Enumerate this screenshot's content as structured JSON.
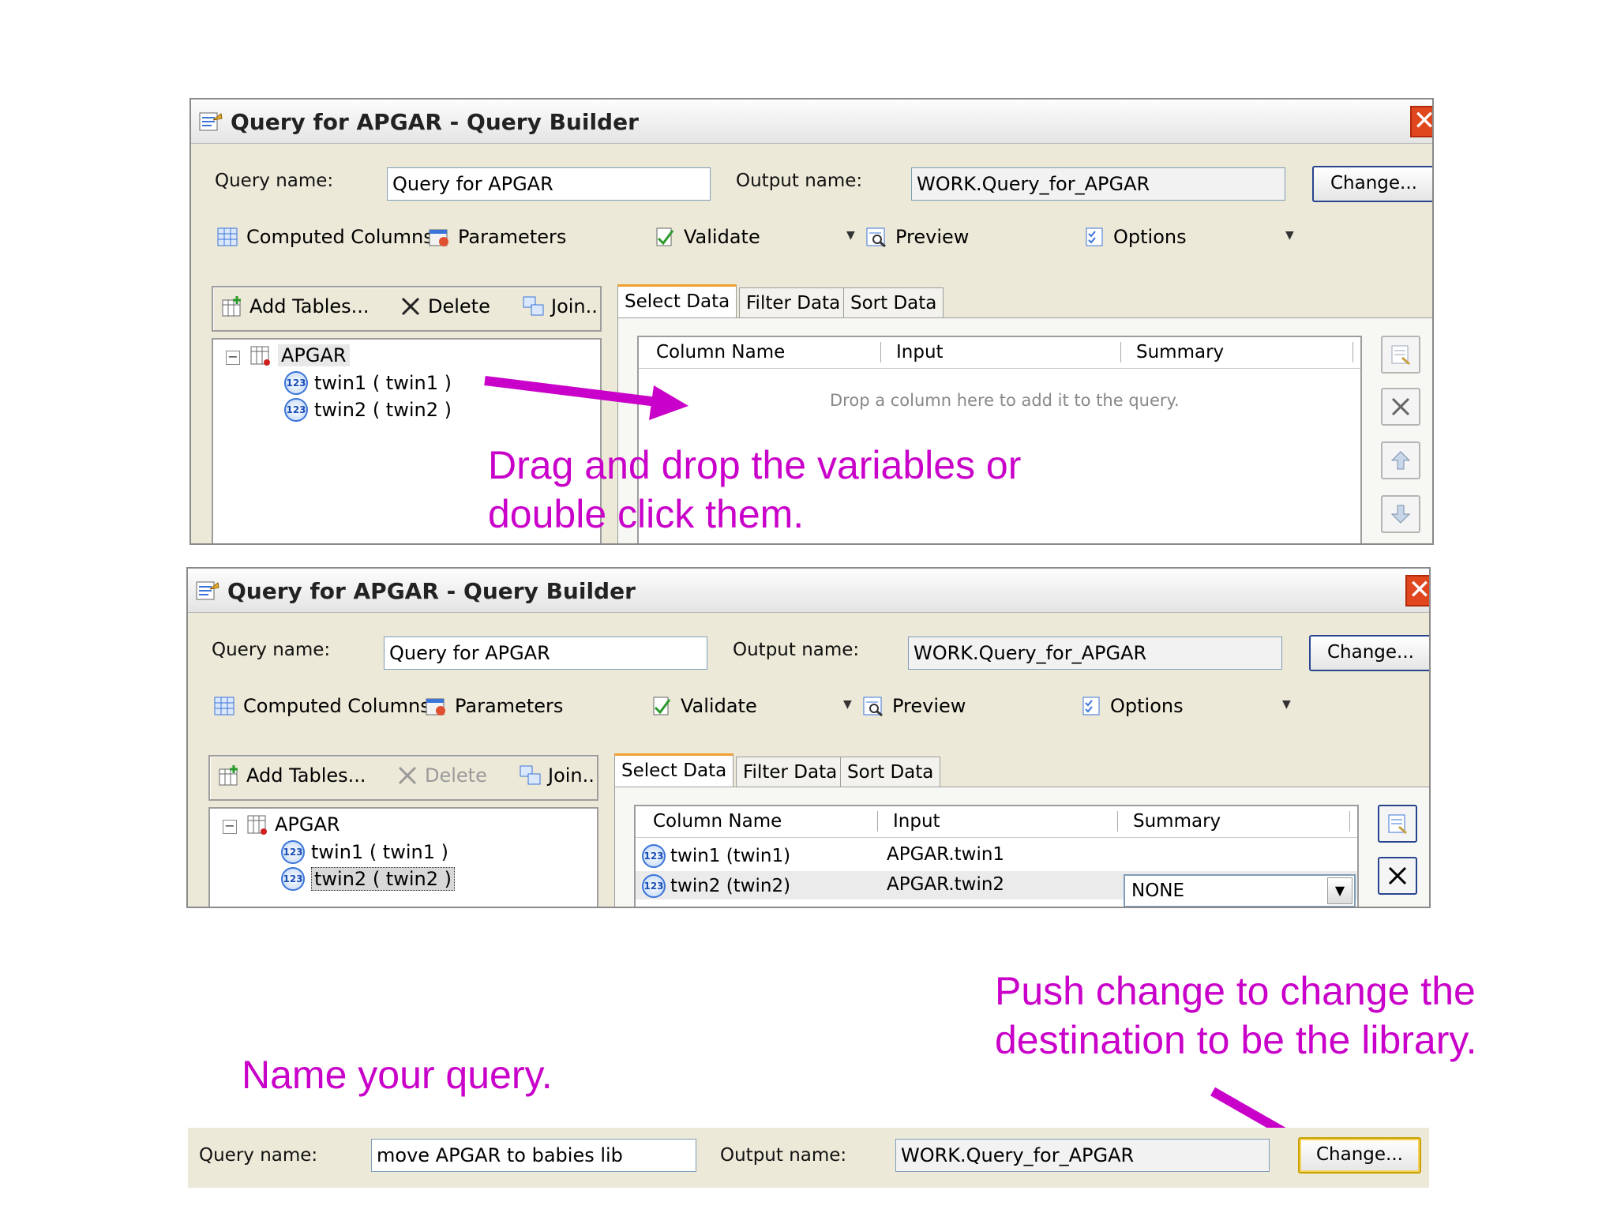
{
  "window1": {
    "title": "Query for APGAR - Query Builder",
    "close_glyph": "✕",
    "query_name_label": "Query name:",
    "query_name_value": "Query for APGAR",
    "output_name_label": "Output name:",
    "output_name_value": "WORK.Query_for_APGAR",
    "change_label": "Change...",
    "toolbar": {
      "computed_columns": "Computed Columns",
      "parameters": "Parameters",
      "validate": "Validate",
      "preview": "Preview",
      "options": "Options"
    },
    "table_tools": {
      "add_tables": "Add Tables...",
      "delete": "Delete",
      "join": "Join.."
    },
    "tree": {
      "table": "APGAR",
      "vars": [
        "twin1 ( twin1 )",
        "twin2 ( twin2 )"
      ]
    },
    "tabs": [
      "Select Data",
      "Filter Data",
      "Sort Data"
    ],
    "grid_headers": [
      "Column Name",
      "Input",
      "Summary"
    ],
    "placeholder": "Drop a column here to add it to the query."
  },
  "window2": {
    "title": "Query for APGAR - Query Builder",
    "close_glyph": "✕",
    "query_name_label": "Query name:",
    "query_name_value": "Query for APGAR",
    "output_name_label": "Output name:",
    "output_name_value": "WORK.Query_for_APGAR",
    "change_label": "Change...",
    "toolbar": {
      "computed_columns": "Computed Columns",
      "parameters": "Parameters",
      "validate": "Validate",
      "preview": "Preview",
      "options": "Options"
    },
    "table_tools": {
      "add_tables": "Add Tables...",
      "delete": "Delete",
      "join": "Join.."
    },
    "tree": {
      "table": "APGAR",
      "vars": [
        "twin1 ( twin1 )",
        "twin2 ( twin2 )"
      ]
    },
    "tabs": [
      "Select Data",
      "Filter Data",
      "Sort Data"
    ],
    "grid_headers": [
      "Column Name",
      "Input",
      "Summary"
    ],
    "rows": [
      {
        "column": "twin1 (twin1)",
        "input": "APGAR.twin1",
        "summary": ""
      },
      {
        "column": "twin2 (twin2)",
        "input": "APGAR.twin2",
        "summary": "NONE"
      }
    ]
  },
  "strip": {
    "query_name_label": "Query name:",
    "query_name_value": "move APGAR to babies lib",
    "output_name_label": "Output name:",
    "output_name_value": "WORK.Query_for_APGAR",
    "change_label": "Change..."
  },
  "annotations": {
    "drag_line1": "Drag and drop the variables or",
    "drag_line2": "double click them.",
    "push_line1": "Push change to change the",
    "push_line2": "destination to be the library.",
    "name_query": "Name your query."
  },
  "colors": {
    "annotation": "#c900c9",
    "window_bg": "#ece9d8",
    "active_tab": "#f0a030",
    "close": "#e0471f"
  }
}
